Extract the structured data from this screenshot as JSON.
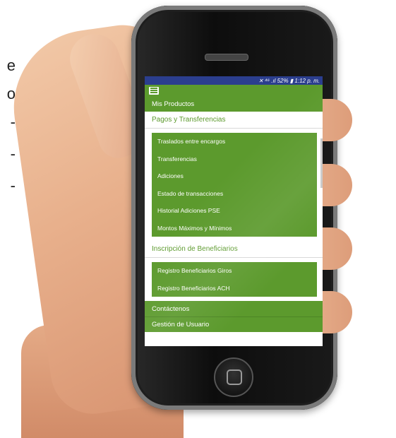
{
  "status_bar": {
    "text": "✕  ⁴⁶ .ıl 52% ▮ 1:12 p. m."
  },
  "nav": {
    "mis_productos": "Mis Productos",
    "pagos_section": "Pagos y Transferencias",
    "pagos_items": [
      "Traslados entre encargos",
      "Transferencias",
      "Adiciones",
      "Estado de transacciones",
      "Historial Adiciones PSE",
      "Montos Máximos y Mínimos"
    ],
    "inscripcion_section": "Inscripción de Beneficiarios",
    "inscripcion_items": [
      "Registro Beneficiarios Giros",
      "Registro Beneficiarios ACH"
    ],
    "contactenos": "Contáctenos",
    "gestion_usuario": "Gestión de Usuario"
  },
  "edge_glyphs": [
    "e",
    "o",
    "-",
    "-",
    "-"
  ],
  "colors": {
    "brand_green": "#5c9a2d",
    "status_blue": "#2b3e8e"
  }
}
